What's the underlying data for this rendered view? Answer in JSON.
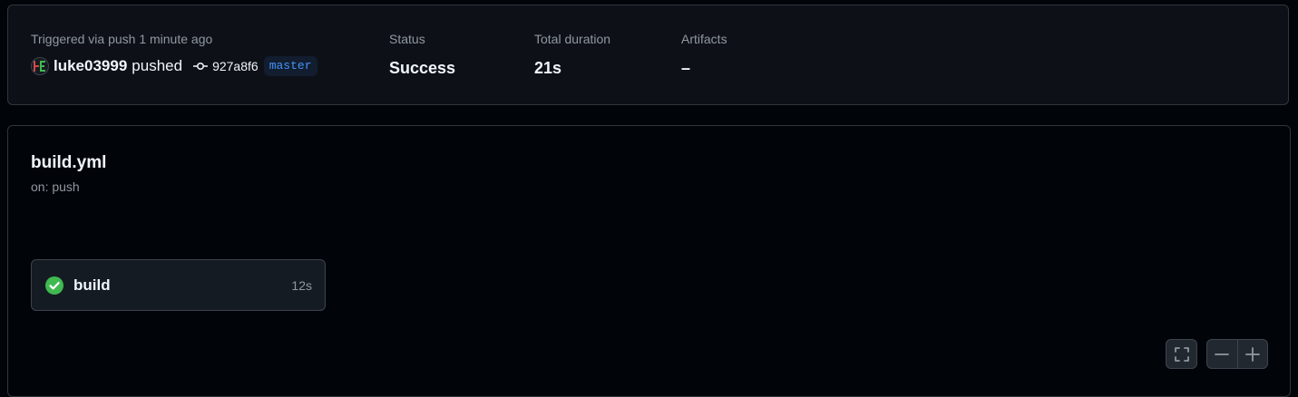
{
  "summary": {
    "trigger_label": "Triggered via push 1 minute ago",
    "actor": "luke03999",
    "action": "pushed",
    "commit_sha": "927a8f6",
    "branch": "master",
    "status_label": "Status",
    "status_value": "Success",
    "duration_label": "Total duration",
    "duration_value": "21s",
    "artifacts_label": "Artifacts",
    "artifacts_value": "–"
  },
  "workflow": {
    "name": "build.yml",
    "trigger": "on: push",
    "jobs": [
      {
        "name": "build",
        "duration": "12s",
        "status": "success"
      }
    ]
  },
  "controls": {
    "fullscreen_icon": "fullscreen-icon",
    "zoom_out_icon": "minus-icon",
    "zoom_in_icon": "plus-icon"
  },
  "colors": {
    "background": "#010409",
    "panel": "#0d1117",
    "border": "#30363d",
    "success": "#3fb950",
    "branch_text": "#4493f8"
  }
}
